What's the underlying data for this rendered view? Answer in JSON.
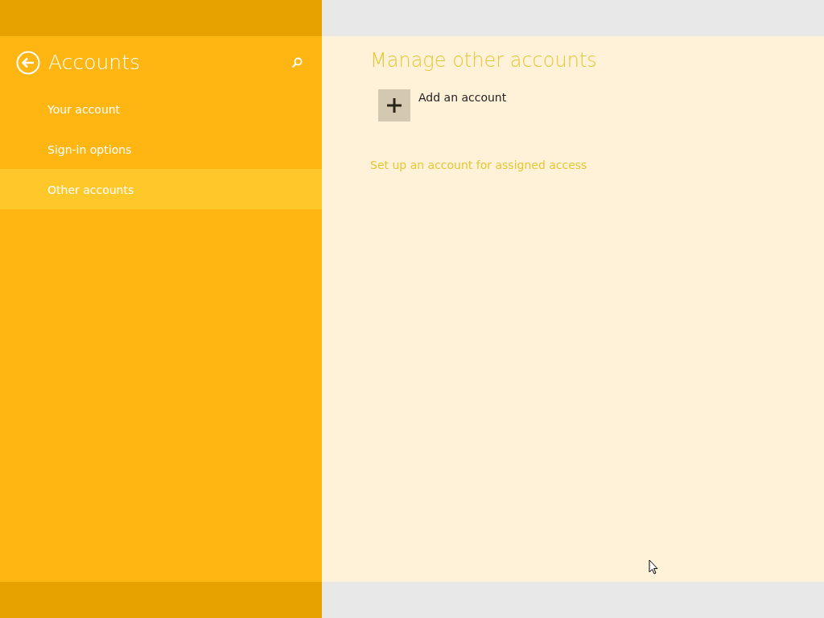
{
  "sidebar": {
    "title": "Accounts",
    "items": [
      {
        "label": "Your account",
        "selected": false
      },
      {
        "label": "Sign-in options",
        "selected": false
      },
      {
        "label": "Other accounts",
        "selected": true
      }
    ]
  },
  "main": {
    "title": "Manage other accounts",
    "add_account": {
      "label": "Add an account"
    },
    "link": "Set up an account for assigned access"
  }
}
